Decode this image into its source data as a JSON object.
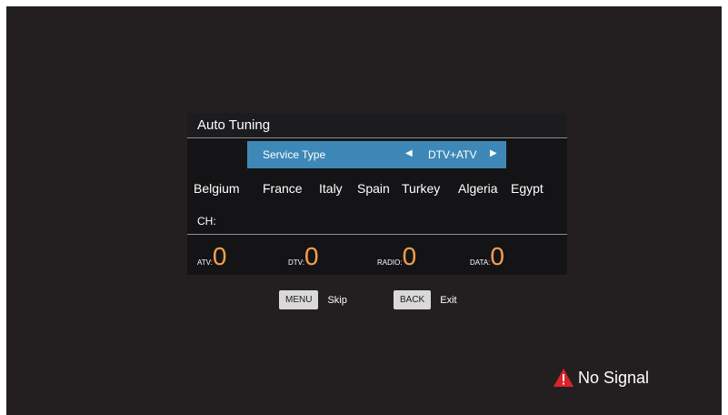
{
  "panel": {
    "title": "Auto Tuning",
    "service_type": {
      "label": "Service Type",
      "value": "DTV+ATV"
    },
    "countries": [
      "Belgium",
      "France",
      "Italy",
      "Spain",
      "Turkey",
      "Algeria",
      "Egypt"
    ],
    "channel_label": "CH:",
    "counts": {
      "atv": {
        "label": "ATV:",
        "value": "0"
      },
      "dtv": {
        "label": "DTV:",
        "value": "0"
      },
      "radio": {
        "label": "RADIO:",
        "value": "0"
      },
      "data": {
        "label": "DATA:",
        "value": "0"
      }
    }
  },
  "keyhints": {
    "menu": {
      "key": "MENU",
      "action": "Skip"
    },
    "back": {
      "key": "BACK",
      "action": "Exit"
    }
  },
  "status": {
    "message": "No Signal",
    "icon": "warning-icon"
  },
  "colors": {
    "background": "#231f20",
    "panel": "#141416",
    "highlight": "#3e88b7",
    "count": "#f5a04a",
    "warning": "#d8232a"
  }
}
